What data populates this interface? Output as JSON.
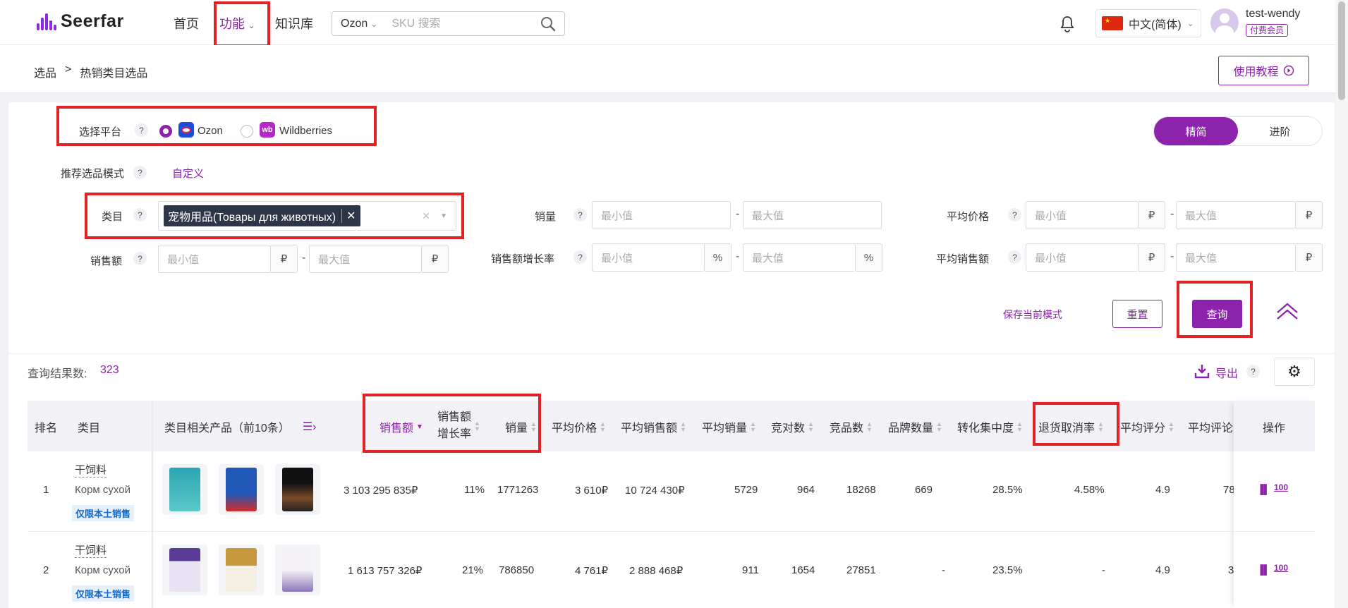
{
  "brand": {
    "name": "Seerfar",
    "accent": "#8d22ad"
  },
  "nav": {
    "items": [
      {
        "label": "首页"
      },
      {
        "label": "功能"
      },
      {
        "label": "知识库"
      }
    ]
  },
  "search": {
    "platform": "Ozon",
    "placeholder": "SKU 搜索"
  },
  "lang": {
    "label": "中文(简体)"
  },
  "user": {
    "name": "test-wendy",
    "badge": "付费会员"
  },
  "breadcrumb": {
    "parent": "选品",
    "sep": ">",
    "current": "热销类目选品"
  },
  "tutorial_label": "使用教程",
  "filters": {
    "platform_label": "选择平台",
    "platforms": [
      {
        "label": "Ozon",
        "selected": true
      },
      {
        "label": "Wildberries",
        "selected": false
      }
    ],
    "mode_label": "推荐选品模式",
    "mode_link": "自定义",
    "segment": [
      "精简",
      "进阶"
    ],
    "category_label": "类目",
    "category_tag": "宠物用品(Товары для животных)",
    "fields": {
      "sales_qty": "销量",
      "avg_price": "平均价格",
      "revenue": "销售额",
      "revenue_growth": "销售额增长率",
      "avg_revenue": "平均销售额"
    },
    "min_placeholder": "最小值",
    "max_placeholder": "最大值",
    "unit_rub": "₽",
    "unit_pct": "%",
    "save_mode": "保存当前模式",
    "reset": "重置",
    "query": "查询"
  },
  "results": {
    "count_label": "查询结果数:",
    "count": "323",
    "export": "导出",
    "columns": {
      "rank": "排名",
      "category": "类目",
      "products": "类目相关产品（前10条）",
      "revenue": "销售额",
      "revenue_growth_1": "销售额",
      "revenue_growth_2": "增长率",
      "qty": "销量",
      "avg_price": "平均价格",
      "avg_revenue": "平均销售额",
      "avg_qty": "平均销量",
      "competitors": "竞对数",
      "competing_products": "竞品数",
      "brands": "品牌数量",
      "conversion": "转化集中度",
      "return_rate": "退货取消率",
      "avg_rating": "平均评分",
      "avg_reviews": "平均评论",
      "actions": "操作"
    },
    "rows": [
      {
        "rank": "1",
        "cat_zh": "干饲料",
        "cat_ru": "Корм сухой",
        "local_tag": "仅限本土销售",
        "revenue": "3 103 295 835₽",
        "growth": "11%",
        "qty": "1771263",
        "avg_price": "3 610₽",
        "avg_revenue": "10 724 430₽",
        "avg_qty": "5729",
        "competitors": "964",
        "competing_products": "18268",
        "brands": "669",
        "conversion": "28.5%",
        "return_rate": "4.58%",
        "avg_rating": "4.9",
        "avg_reviews": "78"
      },
      {
        "rank": "2",
        "cat_zh": "干饲料",
        "cat_ru": "Корм сухой",
        "local_tag": "仅限本土销售",
        "revenue": "1 613 757 326₽",
        "growth": "21%",
        "qty": "786850",
        "avg_price": "4 761₽",
        "avg_revenue": "2 888 468₽",
        "avg_qty": "911",
        "competitors": "1654",
        "competing_products": "27851",
        "brands": "-",
        "conversion": "23.5%",
        "return_rate": "-",
        "avg_rating": "4.9",
        "avg_reviews": "3"
      }
    ]
  }
}
